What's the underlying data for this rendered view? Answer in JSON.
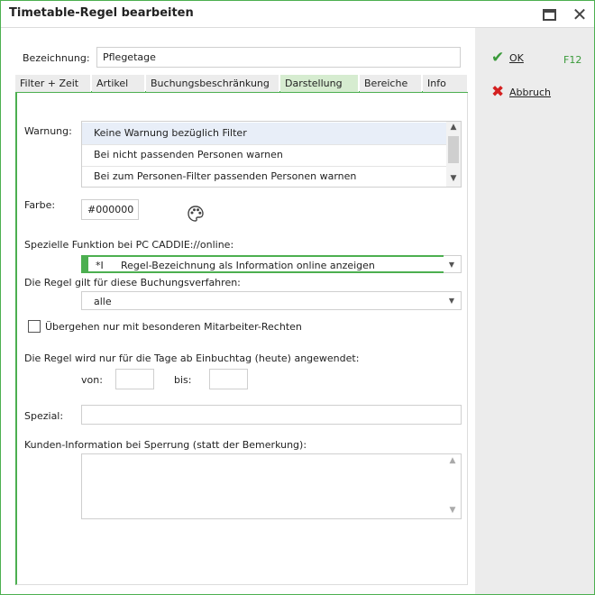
{
  "window": {
    "title": "Timetable-Regel bearbeiten"
  },
  "sidebar": {
    "ok_label": "OK",
    "ok_shortcut": "F12",
    "cancel_label": "Abbruch"
  },
  "form": {
    "bezeichnung_label": "Bezeichnung:",
    "bezeichnung_value": "Pflegetage"
  },
  "tabs": [
    {
      "label": "Filter + Zeit"
    },
    {
      "label": "Artikel"
    },
    {
      "label": "Buchungsbeschränkung"
    },
    {
      "label": "Darstellung"
    },
    {
      "label": "Bereiche"
    },
    {
      "label": "Info"
    }
  ],
  "panel": {
    "warnung_label": "Warnung:",
    "warnung_options": [
      "Keine Warnung bezüglich Filter",
      "Bei nicht passenden Personen warnen",
      "Bei zum Personen-Filter passenden Personen warnen"
    ],
    "farbe_label": "Farbe:",
    "farbe_value": "#000000",
    "online_label": "Spezielle Funktion bei PC CADDIE://online:",
    "online_code": "*I",
    "online_value": "Regel-Bezeichnung als Information online anzeigen",
    "verfahren_label": "Die Regel gilt für diese Buchungsverfahren:",
    "verfahren_value": "alle",
    "checkbox_label": "Übergehen nur mit besonderen Mitarbeiter-Rechten",
    "tage_label": "Die Regel wird nur für die Tage ab Einbuchtag (heute) angewendet:",
    "von_label": "von:",
    "von_value": "",
    "bis_label": "bis:",
    "bis_value": "",
    "spezial_label": "Spezial:",
    "spezial_value": "",
    "kunden_label": "Kunden-Information bei Sperrung (statt der Bemerkung):",
    "kunden_value": ""
  },
  "colors": {
    "accent": "#4caf50",
    "selected_row": "#e8eef8",
    "sidebar_bg": "#ececec",
    "cancel_red": "#d42020"
  }
}
